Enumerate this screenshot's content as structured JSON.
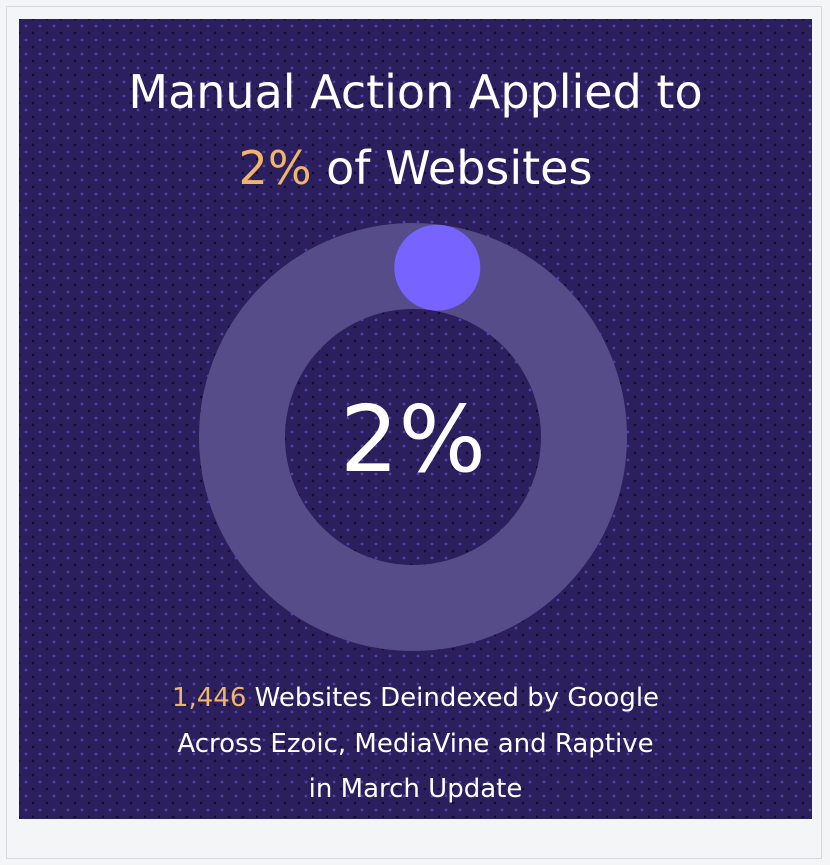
{
  "headline": {
    "line1": "Manual Action Applied to",
    "line2_accent": "2%",
    "line2_rest": " of Websites"
  },
  "chart_data": {
    "type": "pie",
    "values": [
      2,
      98
    ],
    "center_label": "2%",
    "colors": {
      "highlight": "#7763ff",
      "track": "#564c8a"
    }
  },
  "footer": {
    "count": "1,446",
    "line1_rest": " Websites Deindexed by Google",
    "line2": "Across Ezoic, MediaVine and Raptive",
    "line3": "in March Update"
  },
  "colors": {
    "background": "#2b1f5e",
    "accent": "#f0b56b",
    "text": "#ffffff"
  }
}
